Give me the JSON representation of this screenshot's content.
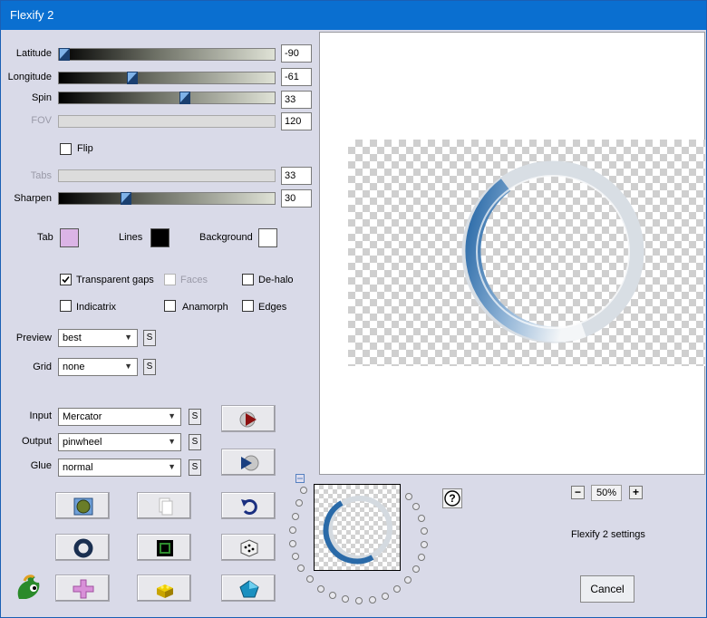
{
  "window": {
    "title": "Flexify 2"
  },
  "sliders": {
    "latitude": {
      "label": "Latitude",
      "value": "-90",
      "fraction": 0.0
    },
    "longitude": {
      "label": "Longitude",
      "value": "-61",
      "fraction": 0.33
    },
    "spin": {
      "label": "Spin",
      "value": "33",
      "fraction": 0.59
    },
    "fov": {
      "label": "FOV",
      "value": "120"
    },
    "tabs": {
      "label": "Tabs",
      "value": "33"
    },
    "sharpen": {
      "label": "Sharpen",
      "value": "30",
      "fraction": 0.3
    }
  },
  "flip": {
    "label": "Flip",
    "checked": false
  },
  "colors": {
    "tab": {
      "label": "Tab",
      "color": "#dbb4e6"
    },
    "lines": {
      "label": "Lines",
      "color": "#000000"
    },
    "background": {
      "label": "Background",
      "color": "#ffffff"
    }
  },
  "options": {
    "transparent_gaps": {
      "label": "Transparent gaps",
      "checked": true
    },
    "faces": {
      "label": "Faces",
      "checked": false
    },
    "de_halo": {
      "label": "De-halo",
      "checked": false
    },
    "indicatrix": {
      "label": "Indicatrix",
      "checked": false
    },
    "anamorph": {
      "label": "Anamorph",
      "checked": false
    },
    "edges": {
      "label": "Edges",
      "checked": false
    }
  },
  "dropdowns": {
    "preview": {
      "label": "Preview",
      "value": "best"
    },
    "grid": {
      "label": "Grid",
      "value": "none"
    },
    "input": {
      "label": "Input",
      "value": "Mercator"
    },
    "output": {
      "label": "Output",
      "value": "pinwheel"
    },
    "glue": {
      "label": "Glue",
      "value": "normal"
    }
  },
  "s_label": "S",
  "help_label": "?",
  "zoom": {
    "value": "50%",
    "minus": "−",
    "plus": "+"
  },
  "settings_label": "Flexify 2 settings",
  "cancel_label": "Cancel",
  "accent": "#0a6fd0",
  "ring_color": "#2f6ea8"
}
